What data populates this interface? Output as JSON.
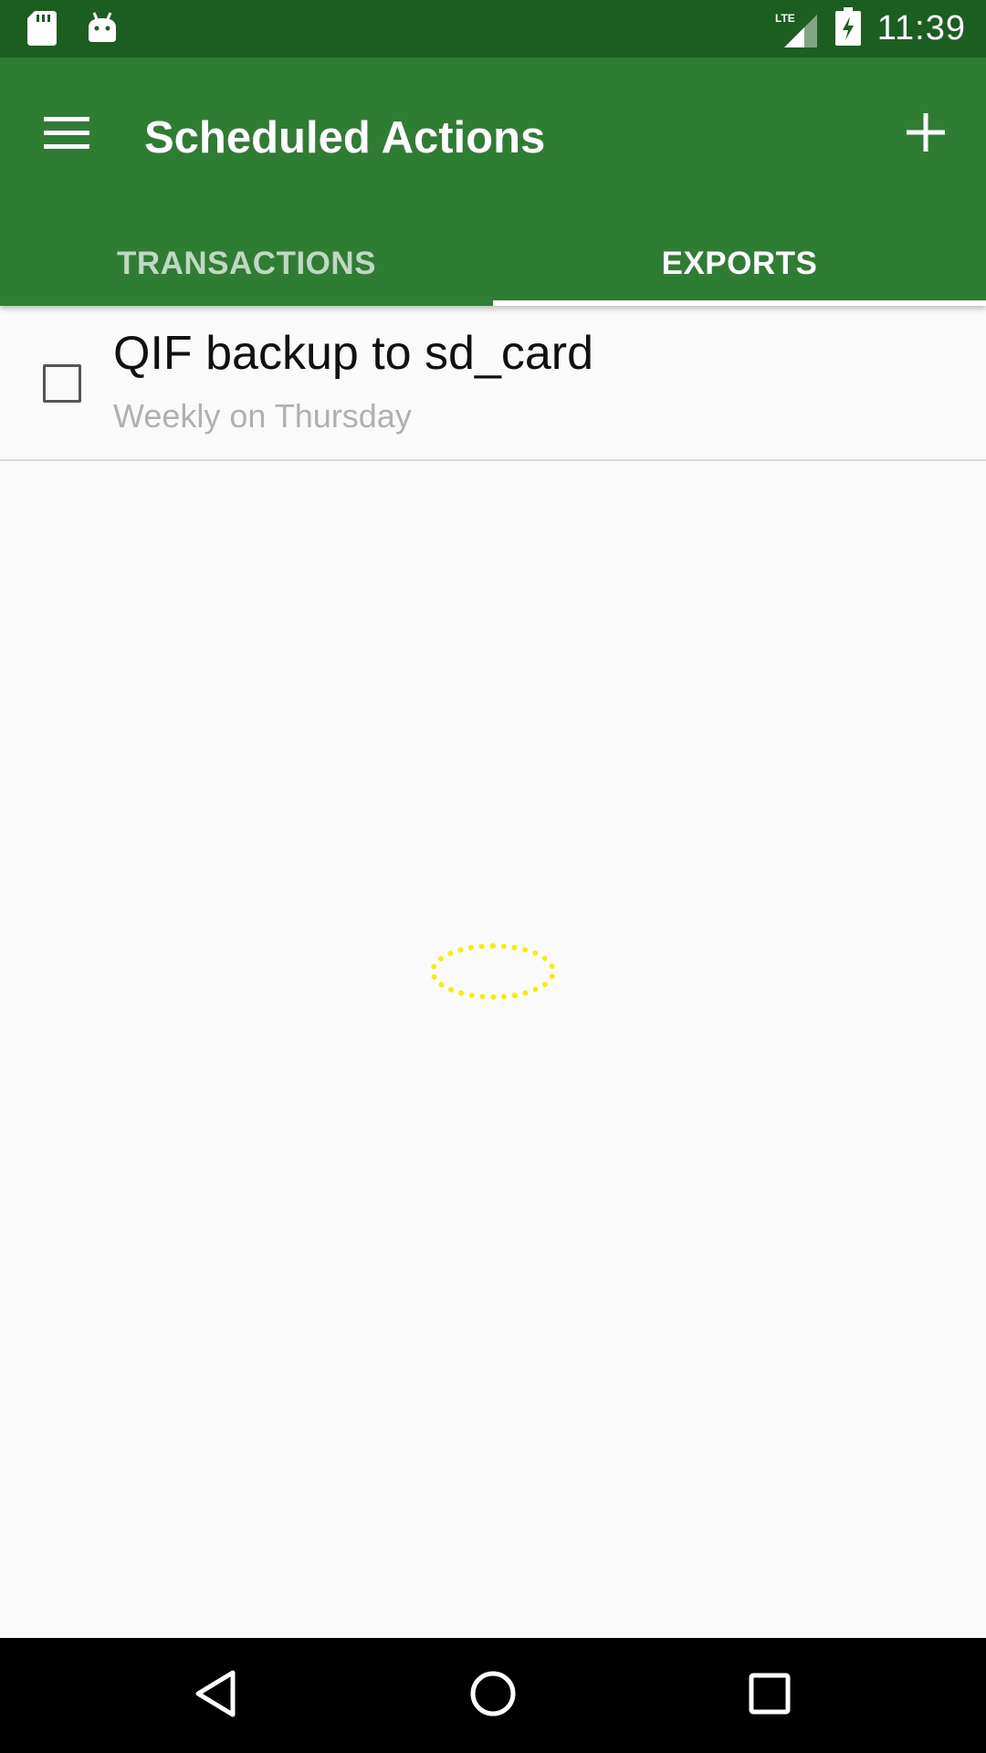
{
  "status_bar": {
    "time": "11:39",
    "network": "LTE",
    "icons": [
      "sd-card-icon",
      "android-icon",
      "lte-signal-icon",
      "battery-charging-icon"
    ]
  },
  "app_bar": {
    "title": "Scheduled Actions",
    "menu_icon": "hamburger-menu-icon",
    "add_icon": "plus-icon"
  },
  "tabs": [
    {
      "label": "TRANSACTIONS",
      "active": false
    },
    {
      "label": "EXPORTS",
      "active": true
    }
  ],
  "list": {
    "items": [
      {
        "title": "QIF backup to sd_card",
        "subtitle": "Weekly on Thursday",
        "checked": false
      }
    ]
  },
  "nav_bar": {
    "icons": [
      "back-icon",
      "home-icon",
      "recents-icon"
    ]
  },
  "colors": {
    "status_bar": "#1b5e20",
    "app_bar": "#2e7d32",
    "background": "#fafafa",
    "spinner": "#f5f000"
  }
}
